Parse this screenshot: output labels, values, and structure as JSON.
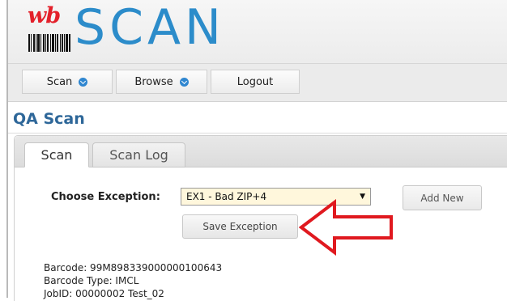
{
  "logo": {
    "prefix": "wb",
    "name": "SCAN"
  },
  "nav": {
    "scan_label": "Scan",
    "browse_label": "Browse",
    "logout_label": "Logout"
  },
  "page": {
    "title": "QA Scan"
  },
  "tabs": [
    {
      "label": "Scan",
      "active": true
    },
    {
      "label": "Scan Log",
      "active": false
    }
  ],
  "form": {
    "exception_label": "Choose Exception:",
    "exception_value": "EX1 - Bad ZIP+4",
    "add_new_label": "Add New",
    "save_label": "Save Exception"
  },
  "details": {
    "barcode": "Barcode: 99M898339000000100643",
    "barcode_type": "Barcode Type: IMCL",
    "job_id": "JobID: 00000002 Test_02"
  },
  "colors": {
    "brand_blue": "#2c8cca",
    "brand_red": "#e3202a",
    "title_blue": "#2e6799",
    "annotation_red": "#e0191f",
    "select_bg": "#fff7dc"
  }
}
